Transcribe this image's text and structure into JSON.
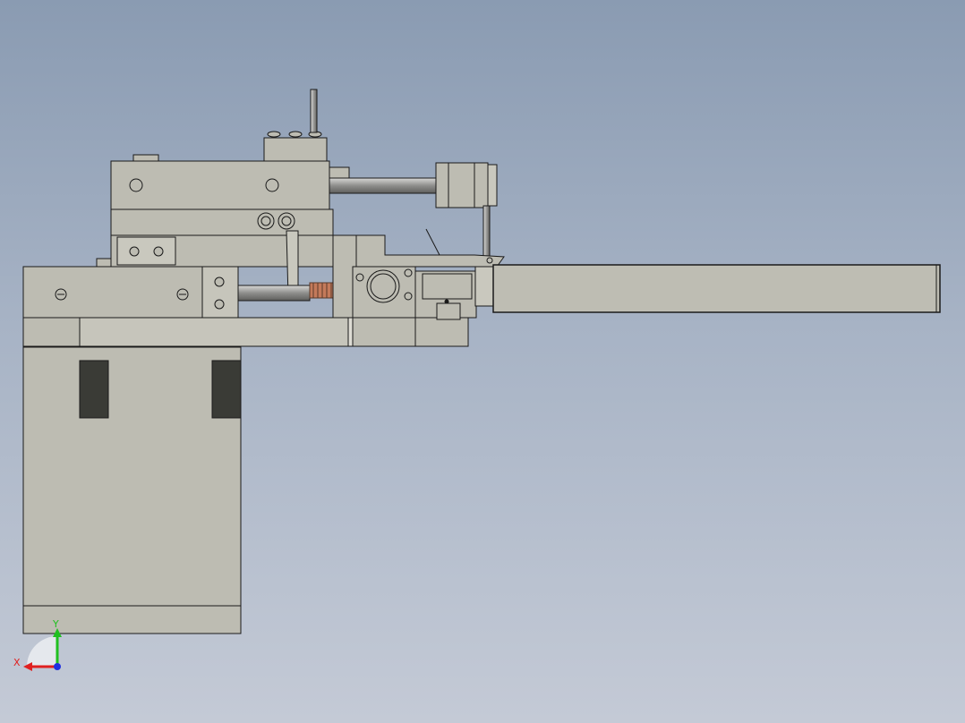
{
  "triad": {
    "x_label": "X",
    "y_label": "Y"
  },
  "colors": {
    "viewport_top": "#8a9bb2",
    "viewport_bottom": "#c4cad6",
    "part_fill": "#bdbcb2",
    "part_fill_light": "#c9c8be",
    "part_stroke": "#1a1a1a",
    "rod_fill": "#9c9c9a",
    "dark_block": "#3a3b36",
    "axis_x": "#e02020",
    "axis_y": "#20c020",
    "axis_z": "#2030e0"
  }
}
